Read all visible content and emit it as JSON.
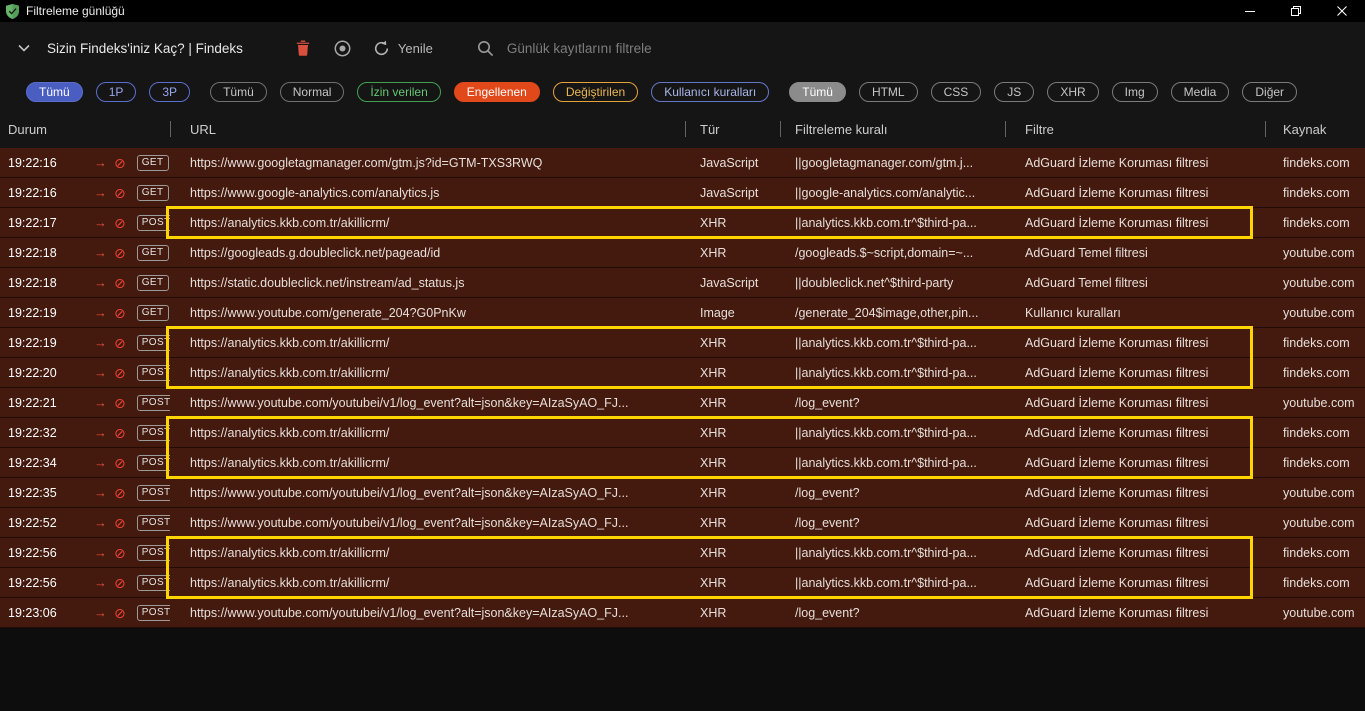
{
  "window": {
    "title": "Filtreleme günlüğü"
  },
  "toolbar": {
    "tab_selector": "Sizin Findeks'iniz Kaç? | Findeks",
    "refresh_label": "Yenile",
    "search_placeholder": "Günlük kayıtlarını filtrele"
  },
  "icons": {
    "outbound_arrow": "→",
    "blocked": "⊘"
  },
  "colors": {
    "blocked_row": "#44190e",
    "highlight": "#ffd500",
    "blocked_chip": "#e2491a"
  },
  "filter_chips": {
    "party": [
      {
        "label": "Tümü",
        "bg": "#4a5ec2",
        "border": "#5a6ed0",
        "color": "#ffffff"
      },
      {
        "label": "1P",
        "border": "#5b6ece",
        "color": "#97a6ee"
      },
      {
        "label": "3P",
        "border": "#5b6ece",
        "color": "#97a6ee"
      }
    ],
    "status": [
      {
        "label": "Tümü",
        "border": "#707070",
        "color": "#c6c6c6"
      },
      {
        "label": "Normal",
        "border": "#707070",
        "color": "#c6c6c6"
      },
      {
        "label": "İzin verilen",
        "border": "#44a04f",
        "color": "#67c772"
      },
      {
        "label": "Engellenen",
        "bg": "#e2491a",
        "border": "#e2491a",
        "color": "#ffffff"
      },
      {
        "label": "Değiştirilen",
        "border": "#e5a33c",
        "color": "#eab854"
      },
      {
        "label": "Kullanıcı kuralları",
        "border": "#6577c9",
        "color": "#aab6ea"
      }
    ],
    "request_type": [
      {
        "label": "Tümü",
        "bg": "#8b8b8b",
        "border": "#8b8b8b",
        "color": "#ffffff"
      },
      {
        "label": "HTML",
        "border": "#7a7a7a",
        "color": "#c6c6c6"
      },
      {
        "label": "CSS",
        "border": "#7a7a7a",
        "color": "#c6c6c6"
      },
      {
        "label": "JS",
        "border": "#7a7a7a",
        "color": "#c6c6c6"
      },
      {
        "label": "XHR",
        "border": "#7a7a7a",
        "color": "#c6c6c6"
      },
      {
        "label": "Img",
        "border": "#7a7a7a",
        "color": "#c6c6c6"
      },
      {
        "label": "Media",
        "border": "#7a7a7a",
        "color": "#c6c6c6"
      },
      {
        "label": "Diğer",
        "border": "#7a7a7a",
        "color": "#c6c6c6"
      }
    ]
  },
  "table": {
    "columns": [
      "Durum",
      "URL",
      "Tür",
      "Filtreleme kuralı",
      "Filtre",
      "Kaynak"
    ],
    "rows": [
      {
        "time": "19:22:16",
        "method": "GET",
        "url": "https://www.googletagmanager.com/gtm.js?id=GTM-TXS3RWQ",
        "type": "JavaScript",
        "rule": "||googletagmanager.com/gtm.j...",
        "filter": "AdGuard İzleme Koruması filtresi",
        "source": "findeks.com"
      },
      {
        "time": "19:22:16",
        "method": "GET",
        "url": "https://www.google-analytics.com/analytics.js",
        "type": "JavaScript",
        "rule": "||google-analytics.com/analytic...",
        "filter": "AdGuard İzleme Koruması filtresi",
        "source": "findeks.com"
      },
      {
        "time": "19:22:17",
        "method": "POST",
        "url": "https://analytics.kkb.com.tr/akillicrm/",
        "type": "XHR",
        "rule": "||analytics.kkb.com.tr^$third-pa...",
        "filter": "AdGuard İzleme Koruması filtresi",
        "source": "findeks.com"
      },
      {
        "time": "19:22:18",
        "method": "GET",
        "url": "https://googleads.g.doubleclick.net/pagead/id",
        "type": "XHR",
        "rule": "/googleads.$~script,domain=~...",
        "filter": "AdGuard Temel filtresi",
        "source": "youtube.com"
      },
      {
        "time": "19:22:18",
        "method": "GET",
        "url": "https://static.doubleclick.net/instream/ad_status.js",
        "type": "JavaScript",
        "rule": "||doubleclick.net^$third-party",
        "filter": "AdGuard Temel filtresi",
        "source": "youtube.com"
      },
      {
        "time": "19:22:19",
        "method": "GET",
        "url": "https://www.youtube.com/generate_204?G0PnKw",
        "type": "Image",
        "rule": "/generate_204$image,other,pin...",
        "filter": "Kullanıcı kuralları",
        "source": "youtube.com"
      },
      {
        "time": "19:22:19",
        "method": "POST",
        "url": "https://analytics.kkb.com.tr/akillicrm/",
        "type": "XHR",
        "rule": "||analytics.kkb.com.tr^$third-pa...",
        "filter": "AdGuard İzleme Koruması filtresi",
        "source": "findeks.com"
      },
      {
        "time": "19:22:20",
        "method": "POST",
        "url": "https://analytics.kkb.com.tr/akillicrm/",
        "type": "XHR",
        "rule": "||analytics.kkb.com.tr^$third-pa...",
        "filter": "AdGuard İzleme Koruması filtresi",
        "source": "findeks.com"
      },
      {
        "time": "19:22:21",
        "method": "POST",
        "url": "https://www.youtube.com/youtubei/v1/log_event?alt=json&key=AIzaSyAO_FJ...",
        "type": "XHR",
        "rule": "/log_event?",
        "filter": "AdGuard İzleme Koruması filtresi",
        "source": "youtube.com"
      },
      {
        "time": "19:22:32",
        "method": "POST",
        "url": "https://analytics.kkb.com.tr/akillicrm/",
        "type": "XHR",
        "rule": "||analytics.kkb.com.tr^$third-pa...",
        "filter": "AdGuard İzleme Koruması filtresi",
        "source": "findeks.com"
      },
      {
        "time": "19:22:34",
        "method": "POST",
        "url": "https://analytics.kkb.com.tr/akillicrm/",
        "type": "XHR",
        "rule": "||analytics.kkb.com.tr^$third-pa...",
        "filter": "AdGuard İzleme Koruması filtresi",
        "source": "findeks.com"
      },
      {
        "time": "19:22:35",
        "method": "POST",
        "url": "https://www.youtube.com/youtubei/v1/log_event?alt=json&key=AIzaSyAO_FJ...",
        "type": "XHR",
        "rule": "/log_event?",
        "filter": "AdGuard İzleme Koruması filtresi",
        "source": "youtube.com"
      },
      {
        "time": "19:22:52",
        "method": "POST",
        "url": "https://www.youtube.com/youtubei/v1/log_event?alt=json&key=AIzaSyAO_FJ...",
        "type": "XHR",
        "rule": "/log_event?",
        "filter": "AdGuard İzleme Koruması filtresi",
        "source": "youtube.com"
      },
      {
        "time": "19:22:56",
        "method": "POST",
        "url": "https://analytics.kkb.com.tr/akillicrm/",
        "type": "XHR",
        "rule": "||analytics.kkb.com.tr^$third-pa...",
        "filter": "AdGuard İzleme Koruması filtresi",
        "source": "findeks.com"
      },
      {
        "time": "19:22:56",
        "method": "POST",
        "url": "https://analytics.kkb.com.tr/akillicrm/",
        "type": "XHR",
        "rule": "||analytics.kkb.com.tr^$third-pa...",
        "filter": "AdGuard İzleme Koruması filtresi",
        "source": "findeks.com"
      },
      {
        "time": "19:23:06",
        "method": "POST",
        "url": "https://www.youtube.com/youtubei/v1/log_event?alt=json&key=AIzaSyAO_FJ...",
        "type": "XHR",
        "rule": "/log_event?",
        "filter": "AdGuard İzleme Koruması filtresi",
        "source": "youtube.com"
      }
    ],
    "highlight_groups": [
      {
        "start": 2,
        "end": 2
      },
      {
        "start": 6,
        "end": 7
      },
      {
        "start": 9,
        "end": 10
      },
      {
        "start": 13,
        "end": 14
      }
    ]
  }
}
